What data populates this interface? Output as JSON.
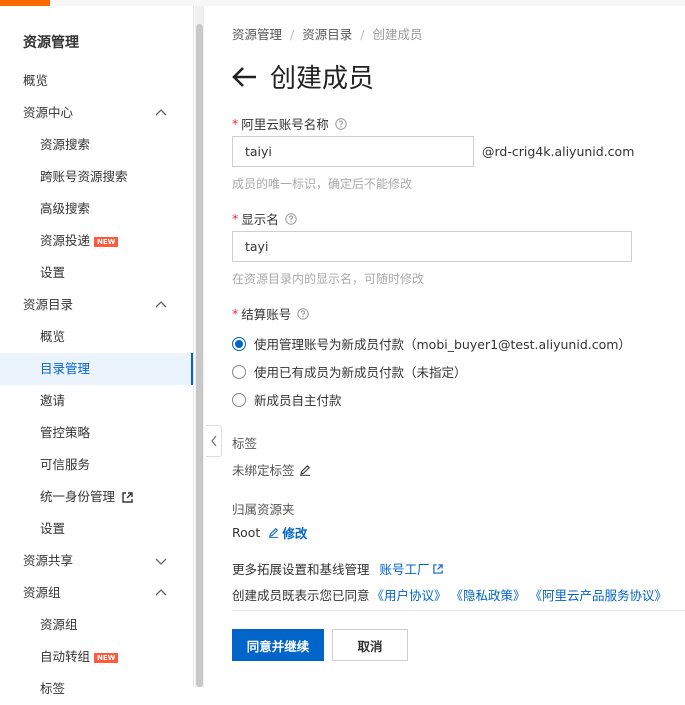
{
  "sidebar": {
    "title": "资源管理",
    "items": [
      {
        "label": "概览"
      },
      {
        "label": "资源中心"
      },
      {
        "label": "资源搜索"
      },
      {
        "label": "跨账号资源搜索"
      },
      {
        "label": "高级搜索"
      },
      {
        "label": "资源投递",
        "badge": "NEW"
      },
      {
        "label": "设置"
      },
      {
        "label": "资源目录"
      },
      {
        "label": "概览"
      },
      {
        "label": "目录管理"
      },
      {
        "label": "邀请"
      },
      {
        "label": "管控策略"
      },
      {
        "label": "可信服务"
      },
      {
        "label": "统一身份管理"
      },
      {
        "label": "设置"
      },
      {
        "label": "资源共享"
      },
      {
        "label": "资源组"
      },
      {
        "label": "资源组"
      },
      {
        "label": "自动转组",
        "badge": "NEW"
      },
      {
        "label": "标签"
      }
    ]
  },
  "breadcrumb": [
    "资源管理",
    "资源目录",
    "创建成员"
  ],
  "page": {
    "title": "创建成员"
  },
  "form": {
    "account_name": {
      "label": "阿里云账号名称",
      "value": "taiyi",
      "suffix": "@rd-crig4k.aliyunid.com",
      "hint": "成员的唯一标识，确定后不能修改"
    },
    "display_name": {
      "label": "显示名",
      "value": "tayi",
      "hint": "在资源目录内的显示名，可随时修改"
    },
    "billing": {
      "label": "结算账号",
      "options": [
        {
          "label": "使用管理账号为新成员付款（mobi_buyer1@test.aliyunid.com）",
          "checked": true
        },
        {
          "label": "使用已有成员为新成员付款（未指定）",
          "checked": false
        },
        {
          "label": "新成员自主付款",
          "checked": false
        }
      ]
    },
    "tags": {
      "label": "标签",
      "value": "未绑定标签"
    },
    "folder": {
      "label": "归属资源夹",
      "value": "Root",
      "edit": "修改"
    },
    "more": {
      "text": "更多拓展设置和基线管理",
      "link": "账号工厂"
    },
    "agreement": {
      "text": "创建成员既表示您已同意",
      "links": [
        "《用户协议》",
        "《隐私政策》",
        "《阿里云产品服务协议》"
      ]
    }
  },
  "actions": {
    "confirm": "同意并继续",
    "cancel": "取消"
  },
  "colors": {
    "accent": "#0064c8",
    "brand": "#ff6a00",
    "required": "#e62e2e",
    "badge": "#ff5a3c"
  }
}
